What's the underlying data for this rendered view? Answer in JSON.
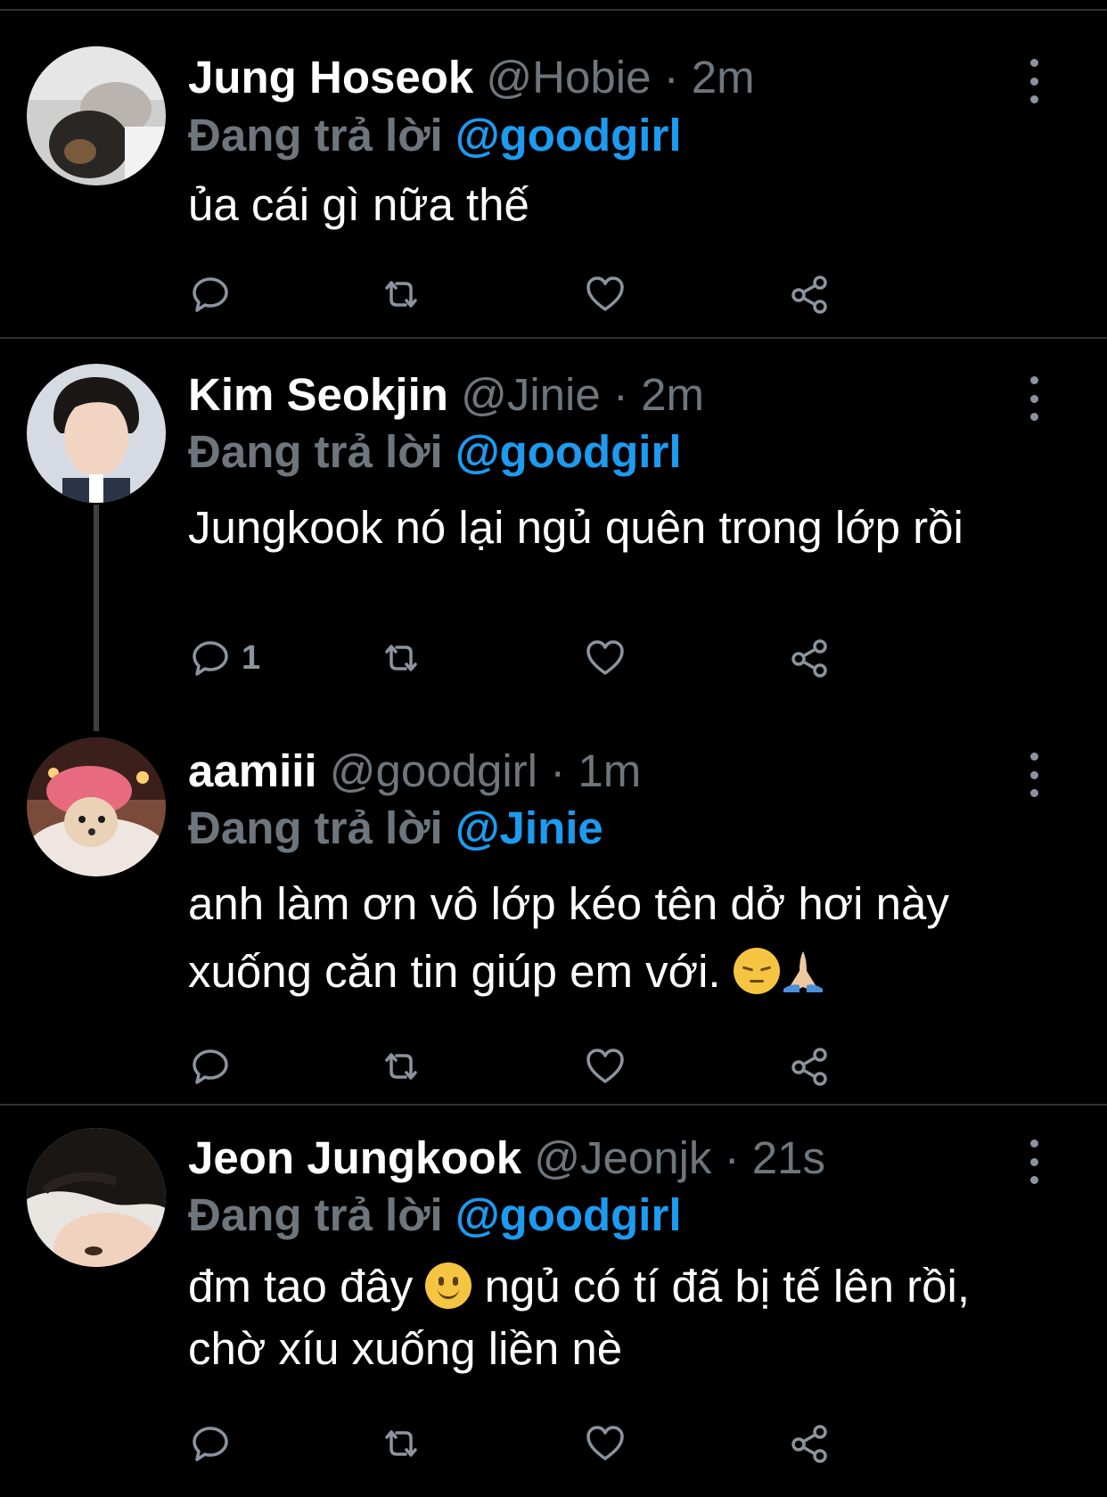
{
  "tweets": [
    {
      "name": "Jung Hoseok",
      "handle": "@Hobie",
      "sep": "·",
      "time": "2m",
      "reply_prefix": "Đang trả lời",
      "reply_to": "@goodgirl",
      "text": "ủa cái gì nữa thế",
      "reply_count": ""
    },
    {
      "name": "Kim Seokjin",
      "handle": "@Jinie",
      "sep": "·",
      "time": "2m",
      "reply_prefix": "Đang trả lời",
      "reply_to": "@goodgirl",
      "text": "Jungkook nó lại ngủ quên trong lớp rồi",
      "reply_count": "1"
    },
    {
      "name": "aamiii",
      "handle": "@goodgirl",
      "sep": "·",
      "time": "1m",
      "reply_prefix": "Đang trả lời",
      "reply_to": "@Jinie",
      "text_part1": "anh làm ơn vô lớp kéo tên dở hơi này xuống căn tin giúp em với.",
      "reply_count": ""
    },
    {
      "name": "Jeon Jungkook",
      "handle": "@Jeonjk",
      "sep": "·",
      "time": "21s",
      "reply_prefix": "Đang trả lời",
      "reply_to": "@goodgirl",
      "text_part1": "đm tao đây",
      "text_part2": "ngủ có tí đã bị tế lên rồi, chờ xíu xuống liền nè",
      "reply_count": ""
    }
  ],
  "icons": {
    "reply": "reply-icon",
    "retweet": "retweet-icon",
    "like": "heart-icon",
    "share": "share-icon",
    "more": "more-icon"
  },
  "colors": {
    "background": "#000000",
    "mention": "#1d9bf0",
    "secondary_text": "#6e767d",
    "divider": "#2f3336"
  }
}
